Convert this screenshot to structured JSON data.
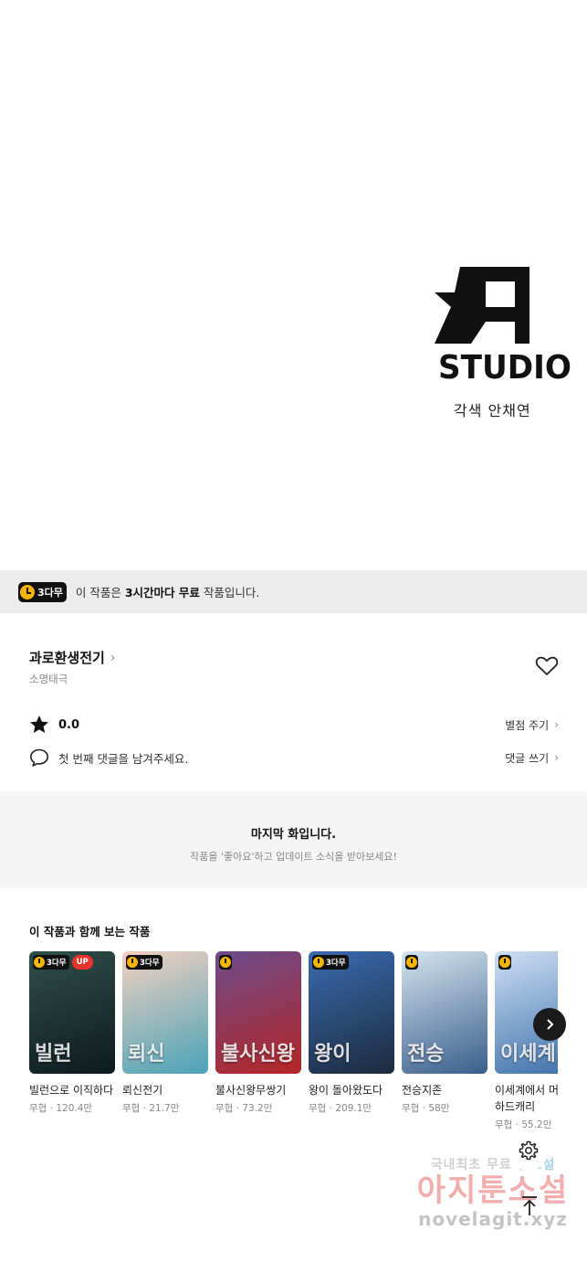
{
  "credit": {
    "studio_name": "STUDIO",
    "studio_credit": "각색 안채연",
    "logo_icon": "a-studio-logo-icon"
  },
  "free_banner": {
    "badge": "3다무",
    "text_prefix": "이 작품은 ",
    "text_bold": "3시간마다 무료",
    "text_suffix": " 작품입니다."
  },
  "series": {
    "title": "과로환생전기",
    "title_chevron": "›",
    "author": "소명태극",
    "rating": "0.0",
    "rate_action": "별점 주기",
    "comment_prompt": "첫 번째 댓글을 남겨주세요.",
    "comment_action": "댓글 쓰기",
    "chevron": "›"
  },
  "last_episode": {
    "title": "마지막 화입니다.",
    "subtitle": "작품을 '좋아요'하고 업데이트 소식을 받아보세요!"
  },
  "recommendations": {
    "title": "이 작품과 함께 보는 작품",
    "items": [
      {
        "title": "빌런으로 이직하다",
        "meta": "무협 · 120.4만",
        "badge": "3다무",
        "up": "UP",
        "art": "빌런",
        "colors": [
          "#2f4f4a",
          "#0e1a1f"
        ]
      },
      {
        "title": "뢰신전기",
        "meta": "무협 · 21.7만",
        "badge": "3다무",
        "up": "",
        "art": "뢰신",
        "colors": [
          "#f2d0c0",
          "#4aa3b8"
        ]
      },
      {
        "title": "불사신왕무쌍기",
        "meta": "무협 · 73.2만",
        "badge": "",
        "up": "",
        "art": "불사신왕",
        "colors": [
          "#6b4a8a",
          "#b52626"
        ]
      },
      {
        "title": "왕이 돌아왔도다",
        "meta": "무협 · 209.1만",
        "badge": "3다무",
        "up": "",
        "art": "왕이",
        "colors": [
          "#3a6bb0",
          "#1c2b3d"
        ]
      },
      {
        "title": "전승지존",
        "meta": "무협 · 58만",
        "badge": "",
        "up": "",
        "art": "전승",
        "colors": [
          "#d4e4f0",
          "#3a5e8a"
        ]
      },
      {
        "title": "이세계에서 머로 하드캐리",
        "meta": "무협 · 55.2만",
        "badge": "",
        "up": "",
        "art": "이세계",
        "colors": [
          "#cfe0f5",
          "#3a6ea8"
        ]
      }
    ]
  },
  "watermark": {
    "line1_a": "국내최초 무료 ",
    "line1_b": "웹소설",
    "line2": "아지툰소설",
    "line3": "novelagit.xyz"
  }
}
